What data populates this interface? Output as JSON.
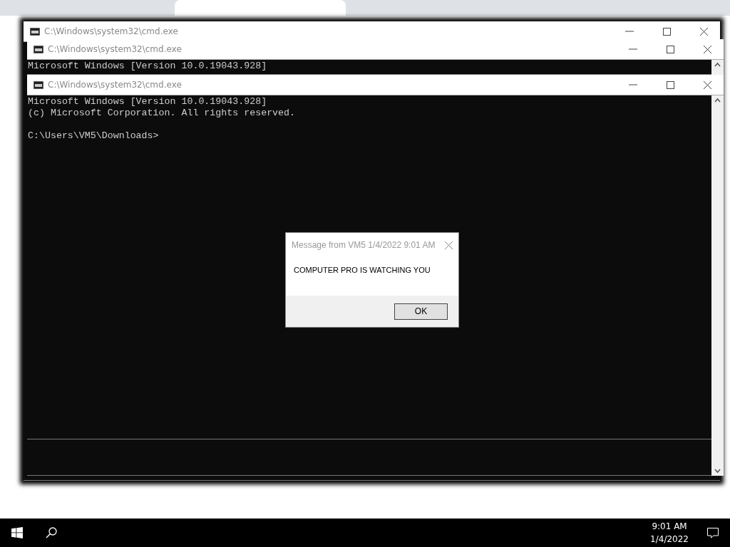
{
  "windows": [
    {
      "title": "C:\\Windows\\system32\\cmd.exe"
    },
    {
      "title": "C:\\Windows\\system32\\cmd.exe",
      "lines": [
        "Microsoft Windows [Version 10.0.19043.928]"
      ]
    },
    {
      "title": "C:\\Windows\\system32\\cmd.exe",
      "lines": [
        "Microsoft Windows [Version 10.0.19043.928]",
        "(c) Microsoft Corporation. All rights reserved."
      ],
      "prompt": "C:\\Users\\VM5\\Downloads>"
    }
  ],
  "dialog": {
    "title": "Message from VM5 1/4/2022 9:01 AM",
    "message": "COMPUTER PRO IS WATCHING YOU",
    "button": "OK"
  },
  "taskbar": {
    "time": "9:01 AM",
    "date": "1/4/2022"
  }
}
